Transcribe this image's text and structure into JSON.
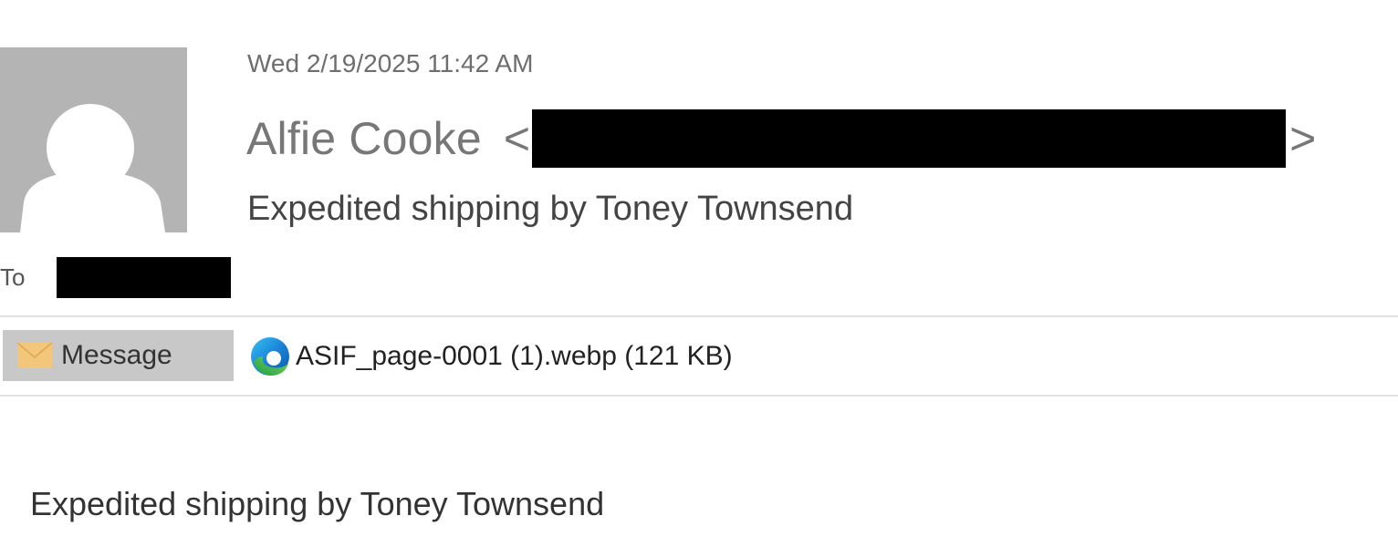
{
  "header": {
    "date": "Wed 2/19/2025 11:42 AM",
    "sender_name": "Alfie Cooke",
    "email_open": "<",
    "email_close": ">",
    "subject": "Expedited shipping by Toney Townsend"
  },
  "recipients": {
    "to_label": "To"
  },
  "tabs": {
    "message_label": "Message",
    "message_icon": "envelope-icon"
  },
  "attachment": {
    "label": "ASIF_page-0001 (1).webp (121 KB)",
    "icon": "edge-browser-icon"
  },
  "body": {
    "text": "Expedited shipping by Toney Townsend"
  },
  "colors": {
    "avatar_bg": "#b4b4b4",
    "tab_bg": "#c8c8c8",
    "envelope": "#f2c77b",
    "redaction": "#000000"
  }
}
